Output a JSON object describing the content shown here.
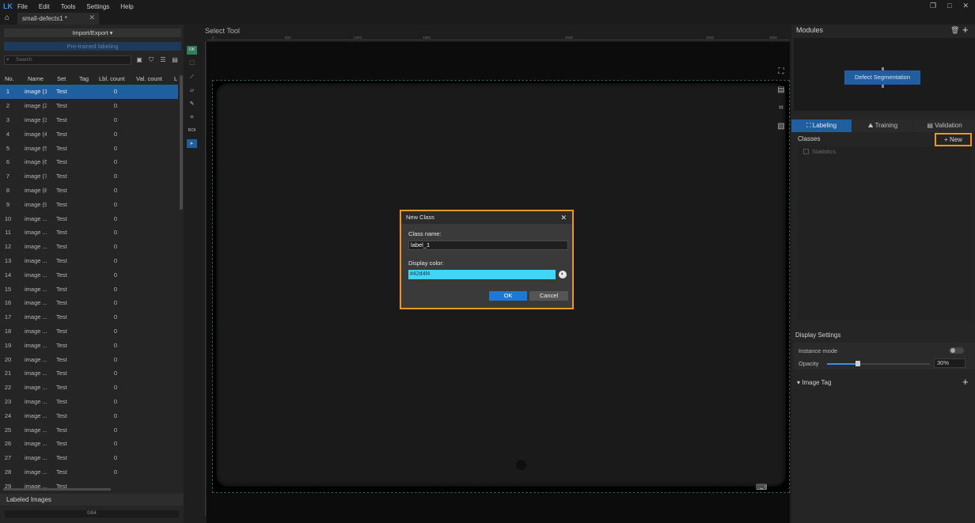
{
  "menu": {
    "logo": "LK",
    "items": [
      "File",
      "Edit",
      "Tools",
      "Settings",
      "Help"
    ]
  },
  "window_controls": {
    "restore": "❐",
    "maximize": "□",
    "close": "✕"
  },
  "tab": {
    "title": "small-defects1 *"
  },
  "left": {
    "import_export": "Import/Export ▾",
    "pretrained": "Pre-trained labeling",
    "search_placeholder": "Search",
    "columns": [
      "No.",
      "Name",
      "Set",
      "Tag",
      "Lbl. count",
      "Val. count",
      "L"
    ],
    "rows": [
      {
        "no": "1",
        "name": "image (1)",
        "set": "Test",
        "lbl": "0"
      },
      {
        "no": "2",
        "name": "image (2)",
        "set": "Test",
        "lbl": "0"
      },
      {
        "no": "3",
        "name": "image (3)",
        "set": "Test",
        "lbl": "0"
      },
      {
        "no": "4",
        "name": "image (4)",
        "set": "Test",
        "lbl": "0"
      },
      {
        "no": "5",
        "name": "image (5)",
        "set": "Test",
        "lbl": "0"
      },
      {
        "no": "6",
        "name": "image (6)",
        "set": "Test",
        "lbl": "0"
      },
      {
        "no": "7",
        "name": "image (7)",
        "set": "Test",
        "lbl": "0"
      },
      {
        "no": "8",
        "name": "image (8)",
        "set": "Test",
        "lbl": "0"
      },
      {
        "no": "9",
        "name": "image (9)",
        "set": "Test",
        "lbl": "0"
      },
      {
        "no": "10",
        "name": "image ...",
        "set": "Test",
        "lbl": "0"
      },
      {
        "no": "11",
        "name": "image ...",
        "set": "Test",
        "lbl": "0"
      },
      {
        "no": "12",
        "name": "image ...",
        "set": "Test",
        "lbl": "0"
      },
      {
        "no": "13",
        "name": "image ...",
        "set": "Test",
        "lbl": "0"
      },
      {
        "no": "14",
        "name": "image ...",
        "set": "Test",
        "lbl": "0"
      },
      {
        "no": "15",
        "name": "image ...",
        "set": "Test",
        "lbl": "0"
      },
      {
        "no": "16",
        "name": "image ...",
        "set": "Test",
        "lbl": "0"
      },
      {
        "no": "17",
        "name": "image ...",
        "set": "Test",
        "lbl": "0"
      },
      {
        "no": "18",
        "name": "image ...",
        "set": "Test",
        "lbl": "0"
      },
      {
        "no": "19",
        "name": "image ...",
        "set": "Test",
        "lbl": "0"
      },
      {
        "no": "20",
        "name": "image ...",
        "set": "Test",
        "lbl": "0"
      },
      {
        "no": "21",
        "name": "image ...",
        "set": "Test",
        "lbl": "0"
      },
      {
        "no": "22",
        "name": "image ...",
        "set": "Test",
        "lbl": "0"
      },
      {
        "no": "23",
        "name": "image ...",
        "set": "Test",
        "lbl": "0"
      },
      {
        "no": "24",
        "name": "image ...",
        "set": "Test",
        "lbl": "0"
      },
      {
        "no": "25",
        "name": "image ...",
        "set": "Test",
        "lbl": "0"
      },
      {
        "no": "26",
        "name": "image ...",
        "set": "Test",
        "lbl": "0"
      },
      {
        "no": "27",
        "name": "image ...",
        "set": "Test",
        "lbl": "0"
      },
      {
        "no": "28",
        "name": "image ...",
        "set": "Test",
        "lbl": "0"
      },
      {
        "no": "29",
        "name": "image ...",
        "set": "Test",
        "lbl": ""
      }
    ],
    "labeled_images": "Labeled Images",
    "progress_text": "0/84"
  },
  "toolbar": {
    "ok": "OK",
    "roi": "ROI"
  },
  "canvas": {
    "title": "Select Tool",
    "ruler": [
      "0",
      "500",
      "1000",
      "1500",
      "2000",
      "2500",
      "3000"
    ]
  },
  "dialog": {
    "title": "New Class",
    "class_name_label": "Class name:",
    "class_name_value": "label_1",
    "color_label": "Display color:",
    "color_value": "#42d4f4",
    "ok": "OK",
    "cancel": "Cancel"
  },
  "right": {
    "modules_title": "Modules",
    "module_node": "Defect Segmentation",
    "tabs": [
      "Labeling",
      "Training",
      "Validation"
    ],
    "tab_icons": [
      "⛶",
      "⛰",
      "▤"
    ],
    "classes_title": "Classes",
    "new_label": "+ New",
    "statistics": "Statistics",
    "display_settings": "Display Settings",
    "instance_mode": "Instance mode",
    "opacity_label": "Opacity",
    "opacity_value": "30%",
    "opacity_fraction": 0.3,
    "image_tag": "▾ Image Tag"
  },
  "colors": {
    "accent": "#1f5fa0",
    "highlight": "#f0961e",
    "label_color": "#42d4f4"
  }
}
